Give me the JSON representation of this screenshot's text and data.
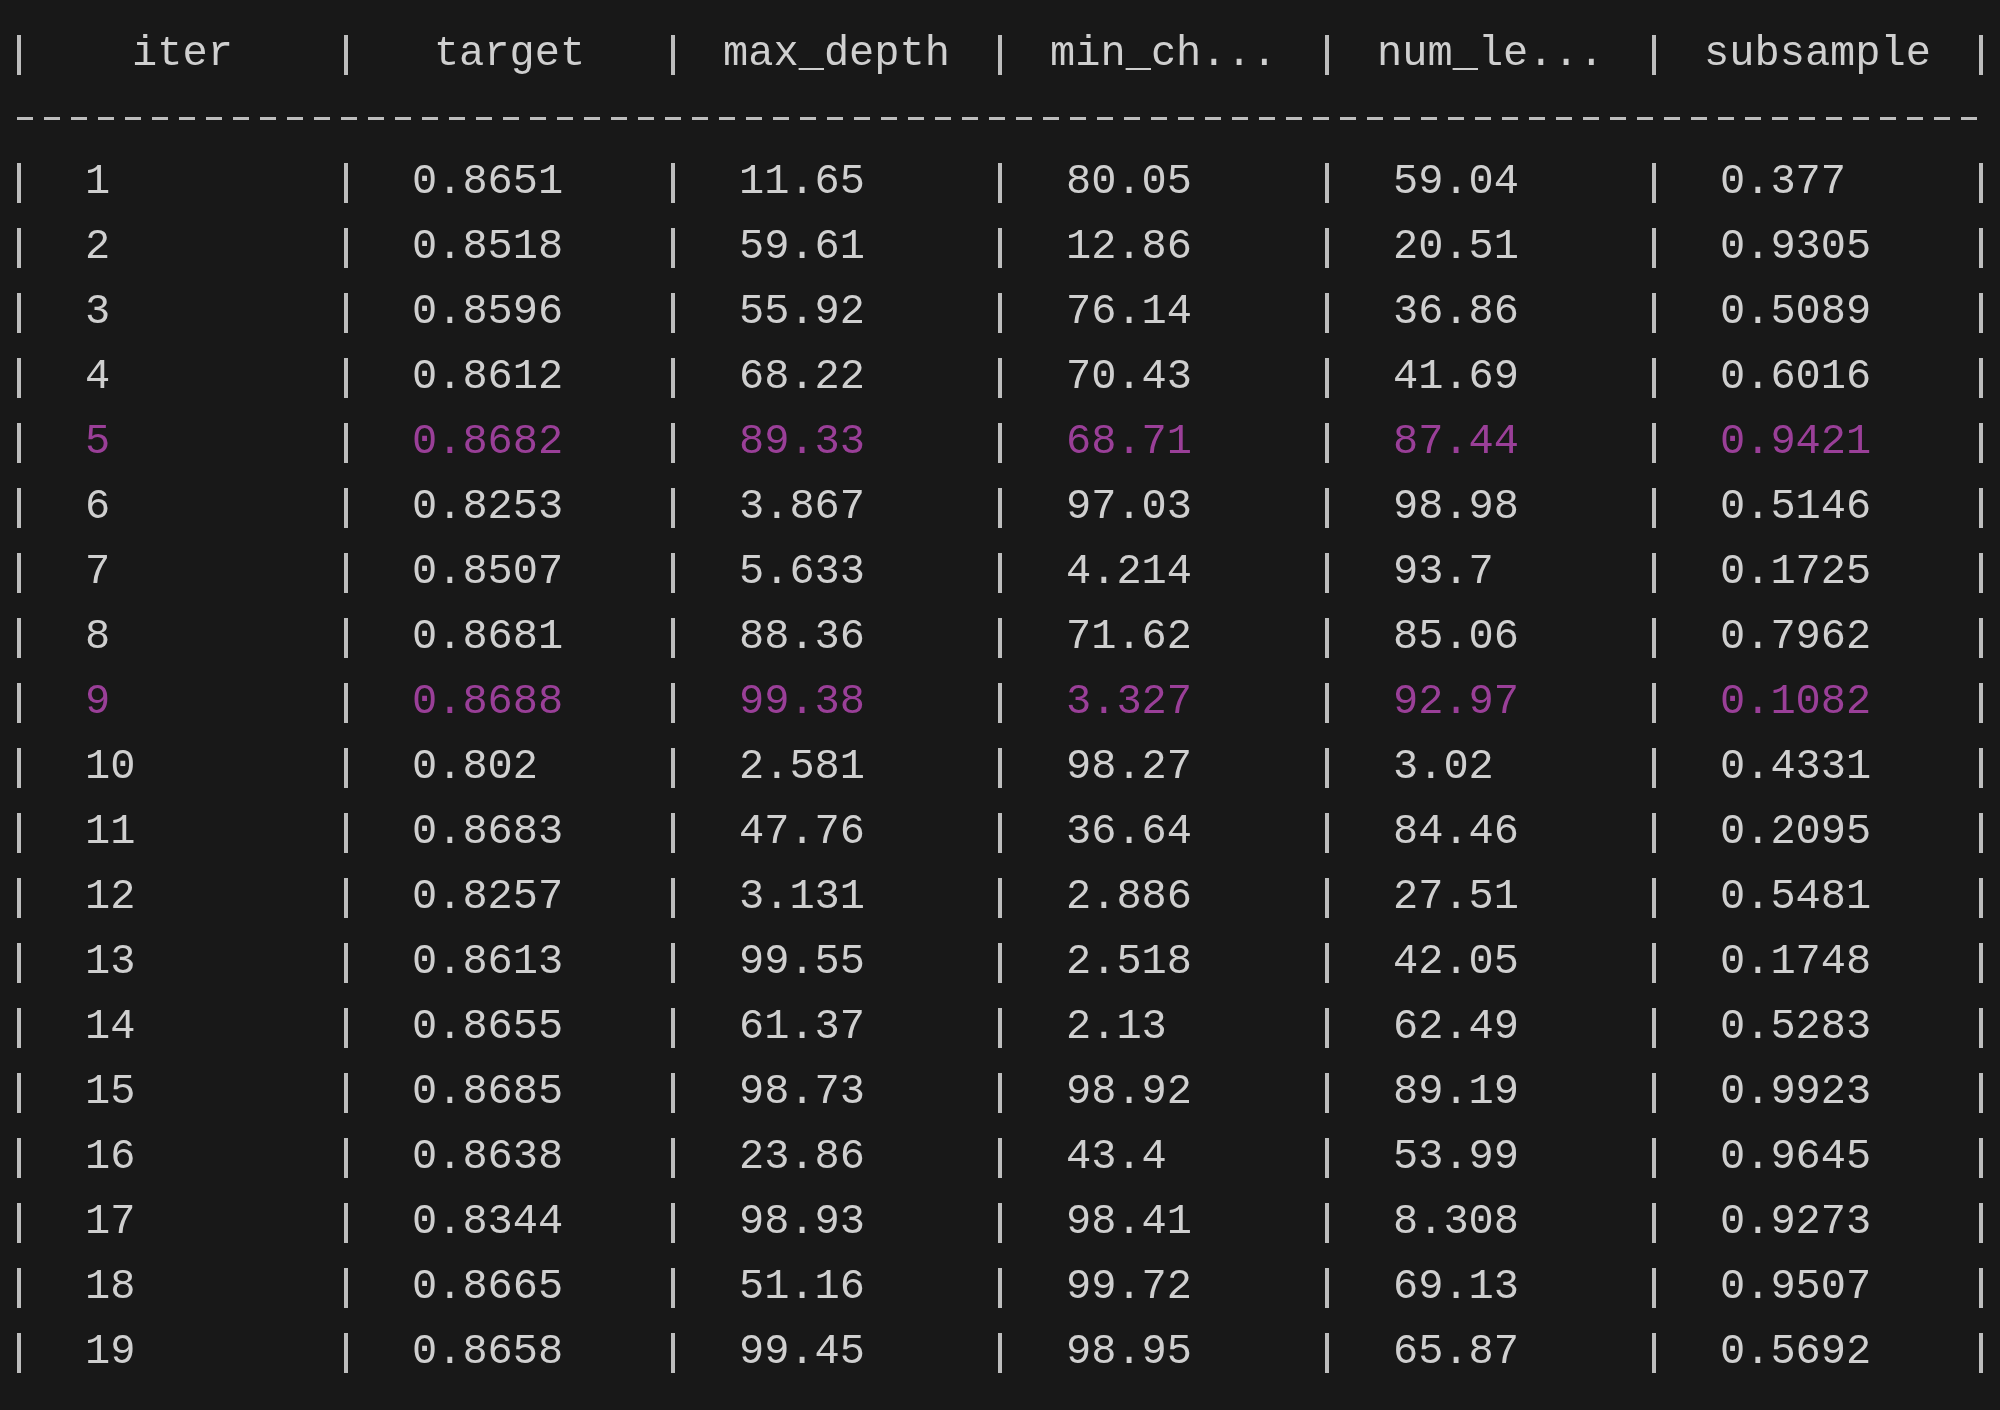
{
  "columns": [
    "iter",
    "target",
    "max_depth",
    "min_ch...",
    "num_le...",
    "subsample"
  ],
  "rows": [
    {
      "cells": [
        "1",
        "0.8651",
        "11.65",
        "80.05",
        "59.04",
        "0.377"
      ],
      "highlighted": false
    },
    {
      "cells": [
        "2",
        "0.8518",
        "59.61",
        "12.86",
        "20.51",
        "0.9305"
      ],
      "highlighted": false
    },
    {
      "cells": [
        "3",
        "0.8596",
        "55.92",
        "76.14",
        "36.86",
        "0.5089"
      ],
      "highlighted": false
    },
    {
      "cells": [
        "4",
        "0.8612",
        "68.22",
        "70.43",
        "41.69",
        "0.6016"
      ],
      "highlighted": false
    },
    {
      "cells": [
        "5",
        "0.8682",
        "89.33",
        "68.71",
        "87.44",
        "0.9421"
      ],
      "highlighted": true
    },
    {
      "cells": [
        "6",
        "0.8253",
        "3.867",
        "97.03",
        "98.98",
        "0.5146"
      ],
      "highlighted": false
    },
    {
      "cells": [
        "7",
        "0.8507",
        "5.633",
        "4.214",
        "93.7",
        "0.1725"
      ],
      "highlighted": false
    },
    {
      "cells": [
        "8",
        "0.8681",
        "88.36",
        "71.62",
        "85.06",
        "0.7962"
      ],
      "highlighted": false
    },
    {
      "cells": [
        "9",
        "0.8688",
        "99.38",
        "3.327",
        "92.97",
        "0.1082"
      ],
      "highlighted": true
    },
    {
      "cells": [
        "10",
        "0.802",
        "2.581",
        "98.27",
        "3.02",
        "0.4331"
      ],
      "highlighted": false
    },
    {
      "cells": [
        "11",
        "0.8683",
        "47.76",
        "36.64",
        "84.46",
        "0.2095"
      ],
      "highlighted": false
    },
    {
      "cells": [
        "12",
        "0.8257",
        "3.131",
        "2.886",
        "27.51",
        "0.5481"
      ],
      "highlighted": false
    },
    {
      "cells": [
        "13",
        "0.8613",
        "99.55",
        "2.518",
        "42.05",
        "0.1748"
      ],
      "highlighted": false
    },
    {
      "cells": [
        "14",
        "0.8655",
        "61.37",
        "2.13",
        "62.49",
        "0.5283"
      ],
      "highlighted": false
    },
    {
      "cells": [
        "15",
        "0.8685",
        "98.73",
        "98.92",
        "89.19",
        "0.9923"
      ],
      "highlighted": false
    },
    {
      "cells": [
        "16",
        "0.8638",
        "23.86",
        "43.4",
        "53.99",
        "0.9645"
      ],
      "highlighted": false
    },
    {
      "cells": [
        "17",
        "0.8344",
        "98.93",
        "98.41",
        "8.308",
        "0.9273"
      ],
      "highlighted": false
    },
    {
      "cells": [
        "18",
        "0.8665",
        "51.16",
        "99.72",
        "69.13",
        "0.9507"
      ],
      "highlighted": false
    },
    {
      "cells": [
        "19",
        "0.8658",
        "99.45",
        "98.95",
        "65.87",
        "0.5692"
      ],
      "highlighted": false
    }
  ]
}
